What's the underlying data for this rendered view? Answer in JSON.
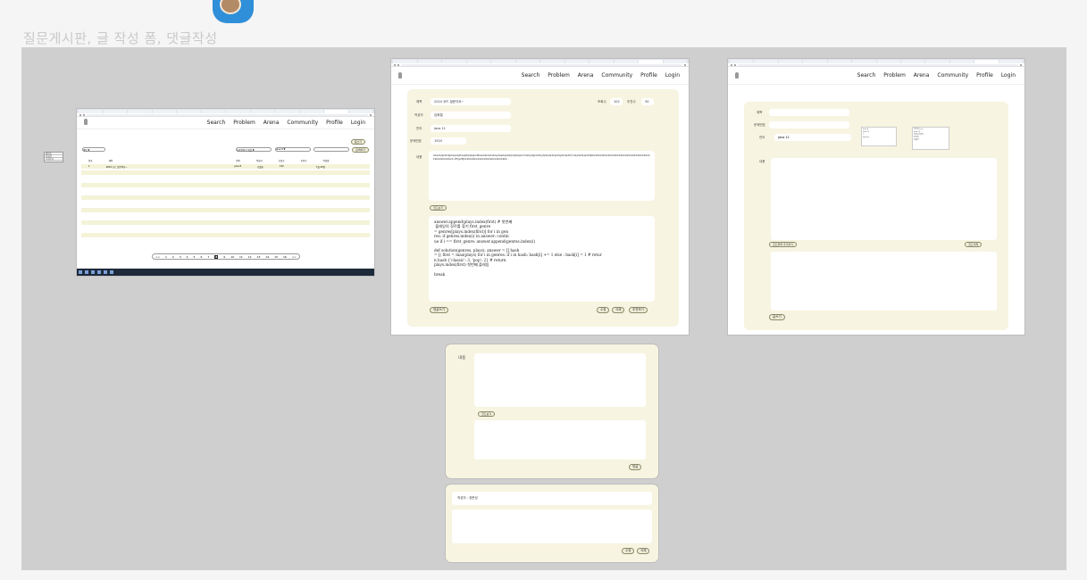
{
  "page_title": "질문게시판, 글 작성 폼, 댓글작성",
  "legend": [
    "제목순",
    "작성자",
    "조회수순"
  ],
  "nav": {
    "items": [
      "Search",
      "Problem",
      "Arena",
      "Community",
      "Profile",
      "Login"
    ]
  },
  "list_frame": {
    "write_button": "글쓰기",
    "sort_select": "제목 ▼",
    "filter_select": "사용언어로 정렬 ▼",
    "lang_select": "Java 8 ▼",
    "search_button": "검색하기",
    "headers": [
      "번호",
      "제목",
      "언어",
      "작성자",
      "조회수",
      "추천수",
      "작성일"
    ],
    "rows": [
      [
        "1",
        "2024 코드 질문이요~",
        "java 8",
        "김철호",
        "152",
        "",
        "7월 22일"
      ]
    ],
    "pages": [
      "<<",
      "1",
      "2",
      "3",
      "4",
      "5",
      "6",
      "7",
      "8",
      "9",
      "10",
      "11",
      "12",
      "13",
      "14",
      "15",
      "16",
      ">>"
    ],
    "active_page": "8"
  },
  "detail_frame": {
    "title_label": "제목",
    "title_value": "2024 코드 질문이요~",
    "views_label": "조회수",
    "views_value": "102",
    "likes_label": "추천수",
    "likes_value": "30",
    "author_label": "작성자",
    "author_value": "김희철",
    "lang_label": "언어",
    "lang_value": "java 11",
    "problem_label": "문제번호",
    "problem_value": "1924",
    "content_label": "내용",
    "content_text": "aksdaljsdklajlkajsdjklsajdlaljkajsdlkasdaklsdsklsjdaslkjsdlkjsdjklajsd lkslkjdsjksdlkjdsdkjlsdkjsdlsjdkljsdlkl lsbjdsdkjsdkfjkkkkkkkkkkkkkkkkkkkkkkkkkkkkkkkkkkkkkkkkkkkkkkkkkkk zfhjsdfjkkkkkkkkkkkkkkkkkkkkkkkkkkkk",
    "code_view_button": "코드보기",
    "code_lines": [
      "answer.append(plays.index(first) # 첫번째",
      " 플레잉의 장르를 찾기 first_genre",
      "= genres[plays.index(first)] for i in gen",
      "res: if genres.index(i) in answer: contin",
      "ue if i == first_genre: answer.append(genres.index(i)",
      "",
      "def solution(genres, plays): answer = [] hash",
      "= [( first = max(plays) for i in genres: if i in hash: hash[i] += 1 else : hash[i] = 1 # retur",
      "n hash {'classic': 3, 'pop': 2} # return",
      "plays.index(first) 첫번째 플레잉",
      "",
      "break"
    ],
    "comment_button": "댓글쓰기",
    "edit_button": "수정",
    "delete_button": "삭제",
    "like_button": "추천하기"
  },
  "write_frame": {
    "title_label": "제목",
    "problem_label": "문제번호",
    "lang_label": "언어",
    "lang_value": "java 11",
    "content_label": "내용",
    "code_add_button": "코드블럭 추가하기",
    "code_delete_button": "코드삭제",
    "submit_button": "글쓰기",
    "dropdown_a": [
      "java 8",
      "java 11",
      "C",
      "python"
    ],
    "dropdown_b": [
      "C언어/C++",
      "java 11",
      "자바스크립트",
      "파이썬",
      "코틀린"
    ]
  },
  "comment_form": {
    "content_label": "내용",
    "code_button": "코드보기",
    "submit_button": "댓글"
  },
  "comment_view": {
    "author_line": "작성자 : 장준성",
    "edit_button": "수정",
    "delete_button": "삭제"
  }
}
